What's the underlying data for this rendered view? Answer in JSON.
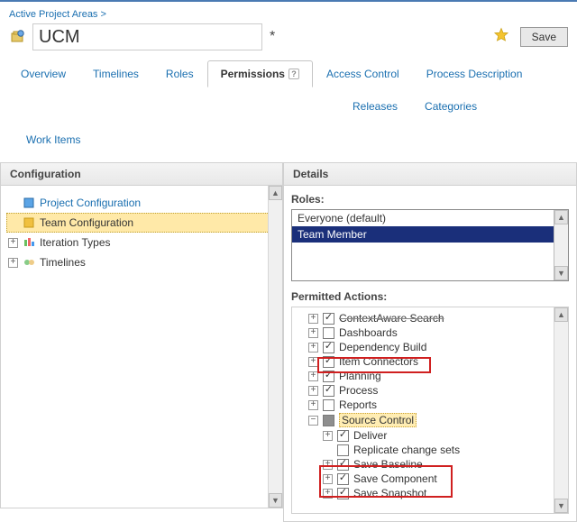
{
  "breadcrumb": {
    "label": "Active Project Areas >"
  },
  "header": {
    "title_value": "UCM",
    "save_label": "Save"
  },
  "tabs": {
    "overview": "Overview",
    "timelines": "Timelines",
    "roles": "Roles",
    "permissions": "Permissions",
    "access_control": "Access Control",
    "process_description": "Process Description",
    "releases": "Releases",
    "categories": "Categories",
    "work_items": "Work Items"
  },
  "panels": {
    "configuration": "Configuration",
    "details": "Details"
  },
  "config_tree": {
    "project_configuration": "Project Configuration",
    "team_configuration": "Team Configuration",
    "iteration_types": "Iteration Types",
    "timelines": "Timelines"
  },
  "details": {
    "roles_label": "Roles:",
    "roles": {
      "everyone": "Everyone (default)",
      "team_member": "Team Member"
    },
    "permitted_label": "Permitted Actions:",
    "actions": {
      "contextaware": "ContextAware Search",
      "dashboards": "Dashboards",
      "dependency_build": "Dependency Build",
      "item_connectors": "Item Connectors",
      "planning": "Planning",
      "process": "Process",
      "reports": "Reports",
      "source_control": "Source Control",
      "deliver": "Deliver",
      "replicate": "Replicate change sets",
      "save_baseline": "Save Baseline",
      "save_component": "Save Component",
      "save_snapshot": "Save Snapshot"
    }
  }
}
